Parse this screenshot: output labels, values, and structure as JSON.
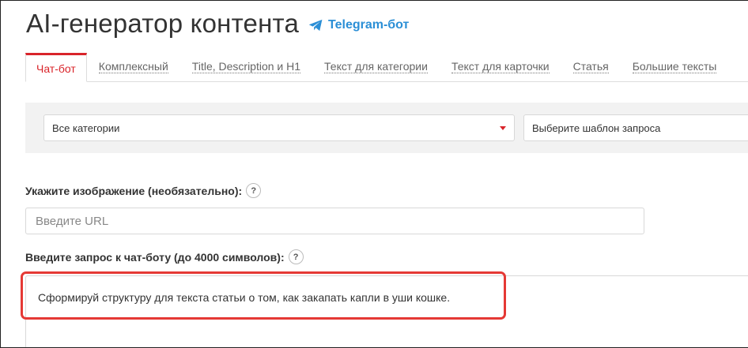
{
  "header": {
    "title": "AI-генератор контента",
    "telegram_link": "Telegram-бот"
  },
  "tabs": [
    {
      "label": "Чат-бот",
      "active": true
    },
    {
      "label": "Комплексный"
    },
    {
      "label": "Title, Description и H1"
    },
    {
      "label": "Текст для категории"
    },
    {
      "label": "Текст для карточки"
    },
    {
      "label": "Статья"
    },
    {
      "label": "Большие тексты"
    }
  ],
  "filters": {
    "category_value": "Все категории",
    "template_value": "Выберите шаблон запроса"
  },
  "image_field": {
    "label": "Укажите изображение (необязательно):",
    "help": "?",
    "placeholder": "Введите URL"
  },
  "query_field": {
    "label": "Введите запрос к чат-боту (до 4000 символов):",
    "help": "?",
    "value": "Сформируй структуру для текста статьи о том, как закапать капли в уши кошке."
  },
  "colors": {
    "accent": "#d9242a",
    "link": "#2b8fd6",
    "highlight": "#e53935"
  }
}
